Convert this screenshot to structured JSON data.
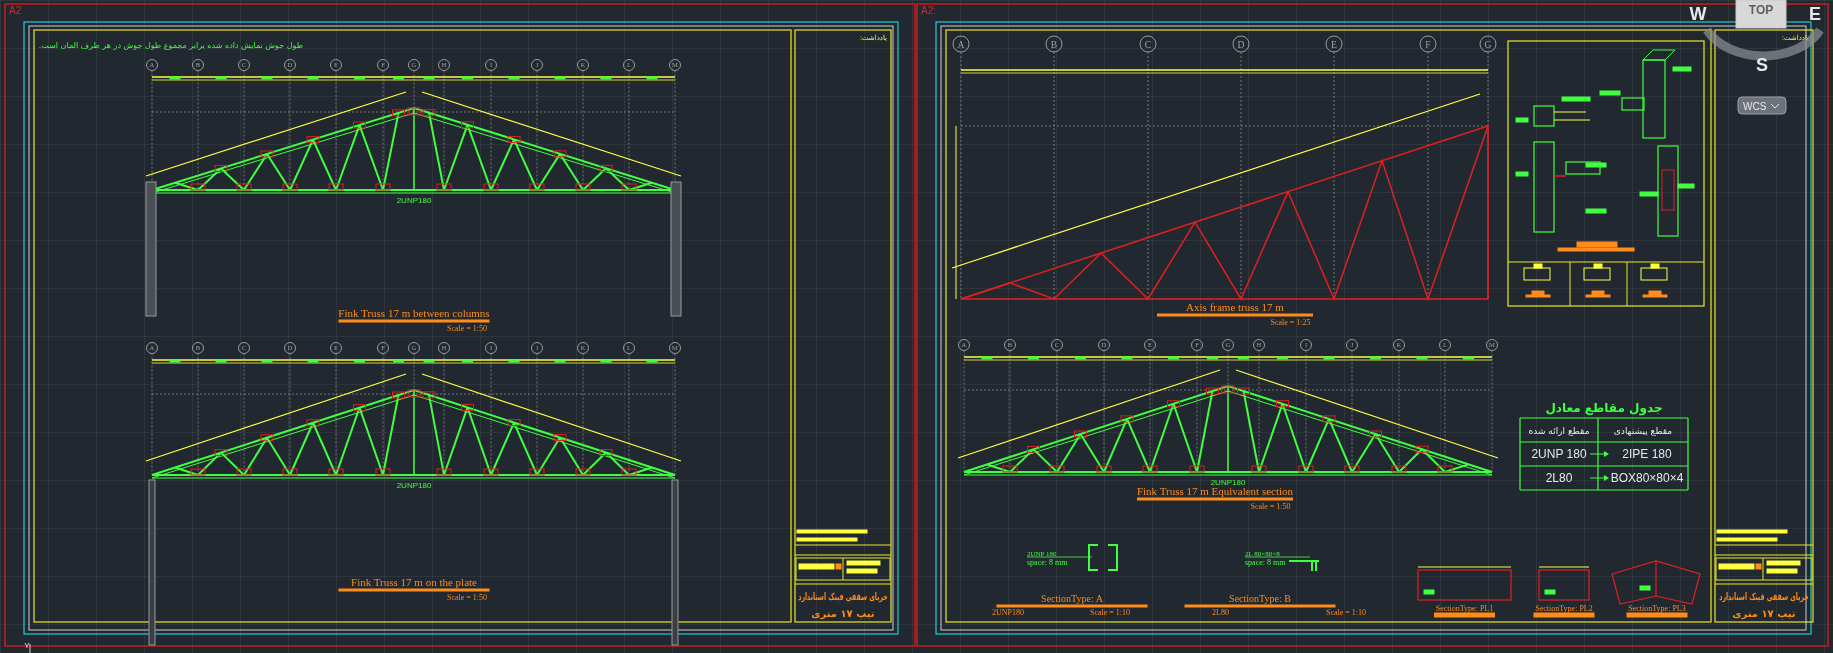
{
  "left_sheet": {
    "label": "A2",
    "note": "طول جوش نمایش داده شده برابر مجموع طول جوش در هر طرف المان است.",
    "trusses": [
      {
        "kind": "on_columns",
        "grid_labels": [
          "A",
          "B",
          "C",
          "D",
          "E",
          "F",
          "G",
          "H",
          "I",
          "J",
          "K",
          "L",
          "M"
        ],
        "member_label": "2UNP180",
        "title": "Fink Truss 17 m between columns",
        "scale": "Scale = 1:50"
      },
      {
        "kind": "on_plate",
        "grid_labels": [
          "A",
          "B",
          "C",
          "D",
          "E",
          "F",
          "G",
          "H",
          "I",
          "J",
          "K",
          "L",
          "M"
        ],
        "member_label": "2UNP180",
        "title": "Fink Truss 17 m on the plate",
        "scale": "Scale = 1:50"
      }
    ],
    "title_block": {
      "note_label": "یادداشت:",
      "title": "خرپای سقفی فینک استاندارد",
      "subtitle": "تیپ ۱۷ متری"
    }
  },
  "right_sheet": {
    "label": "A2:",
    "axis_frame": {
      "grid_labels": [
        "A",
        "B",
        "C",
        "D",
        "E",
        "F",
        "G"
      ],
      "title": "Axis frame truss 17 m",
      "scale": "Scale = 1:25"
    },
    "equivalent_truss": {
      "grid_labels": [
        "A",
        "B",
        "C",
        "D",
        "E",
        "F",
        "G",
        "H",
        "I",
        "J",
        "K",
        "L",
        "M"
      ],
      "member_label": "2UNP180",
      "title": "Fink Truss 17 m Equivalent section",
      "scale": "Scale = 1:50"
    },
    "table": {
      "title": "جدول مقاطع معادل",
      "columns": [
        "مقطع ارائه شده",
        "مقطع پیشنهادی"
      ],
      "rows": [
        [
          "2UNP 180",
          "2IPE 180"
        ],
        [
          "2L80",
          "BOX80×80×4"
        ]
      ]
    },
    "sections": [
      {
        "kind": "double_channel",
        "member": "2UNP 180",
        "spacing": "space: 8 mm",
        "title": "SectionType: A",
        "profile": "2UNP180",
        "scale": "Scale = 1:10"
      },
      {
        "kind": "double_angle",
        "member": "2L 80×80×8",
        "spacing": "space: 8 mm",
        "title": "SectionType: B",
        "profile": "2L80",
        "scale": "Scale = 1:10"
      }
    ],
    "plates": [
      {
        "kind": "wide",
        "title": "SectionType: PL1"
      },
      {
        "kind": "narrow",
        "title": "SectionType: PL2"
      },
      {
        "kind": "bent",
        "title": "SectionType: PL3"
      }
    ],
    "title_block": {
      "note_label": "یادداشت:",
      "title": "خرپای سقفی فینک استاندارد",
      "subtitle": "تیپ ۱۷ متری"
    }
  },
  "viewcube": {
    "west": "W",
    "top": "TOP",
    "east": "E",
    "south": "S",
    "ucs_menu": "WCS"
  },
  "ucs_icon": {
    "axis": "Y"
  }
}
